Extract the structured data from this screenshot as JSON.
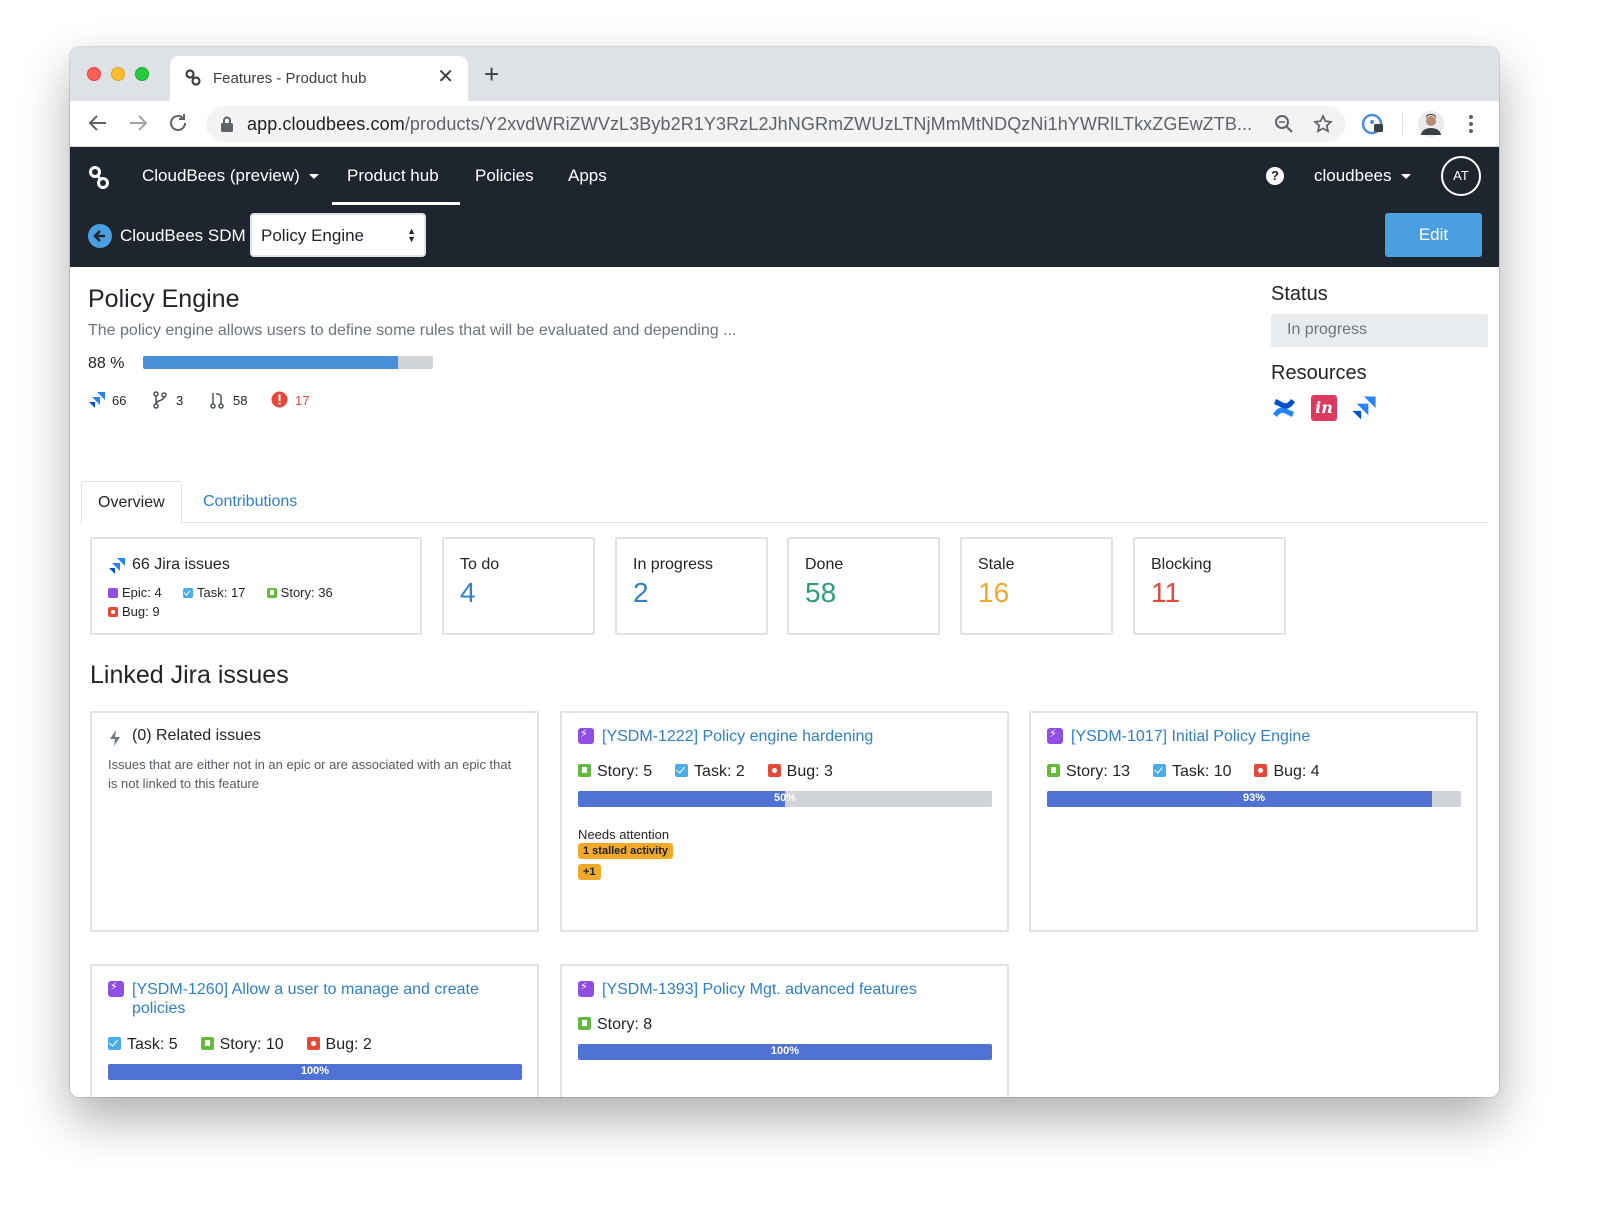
{
  "browser": {
    "tab_title": "Features - Product hub",
    "tab_close": "✕",
    "new_tab": "+",
    "url_host": "app.cloudbees.com",
    "url_path": "/products/Y2xvdWRiZWVzL3Byb2R1Y3RzL2JhNGRmZWUzLTNjMmMtNDQzNi1hYWRlLTkxZGEwZTB..."
  },
  "appnav": {
    "org": "CloudBees (preview)",
    "items": [
      "Product hub",
      "Policies",
      "Apps"
    ],
    "active": "Product hub",
    "help": "?",
    "account": "cloudbees",
    "avatar": "AT"
  },
  "subnav": {
    "title": "CloudBees SDM",
    "selected_feature": "Policy Engine",
    "edit_label": "Edit"
  },
  "feature": {
    "title": "Policy Engine",
    "description": "The policy engine allows users to define some rules that will be evaluated and depending ...",
    "progress_label": "88 %",
    "progress": 0.88,
    "stats": {
      "jira": "66",
      "branches": "3",
      "pulls": "58",
      "alerts": "17"
    }
  },
  "sidebar": {
    "status_heading": "Status",
    "status_value": "In progress",
    "resources_heading": "Resources",
    "resources": [
      "confluence-icon",
      "invision-icon",
      "jira-icon"
    ]
  },
  "tabs": [
    "Overview",
    "Contributions"
  ],
  "summary": {
    "title": "66 Jira issues",
    "epic": "Epic: 4",
    "task": "Task: 17",
    "story": "Story: 36",
    "bug": "Bug: 9"
  },
  "counts": [
    {
      "label": "To do",
      "value": "4",
      "color": "#2f80c6"
    },
    {
      "label": "In progress",
      "value": "2",
      "color": "#2f80c6"
    },
    {
      "label": "Done",
      "value": "58",
      "color": "#2e9d73"
    },
    {
      "label": "Stale",
      "value": "16",
      "color": "#f0a928"
    },
    {
      "label": "Blocking",
      "value": "11",
      "color": "#e5493a"
    }
  ],
  "linked": {
    "heading": "Linked Jira issues",
    "related_title": "(0) Related issues",
    "related_desc": "Issues that are either not in an epic or are associated with an epic that is not linked to this feature",
    "issues": [
      {
        "title": "[YSDM-1222] Policy engine hardening",
        "c1": "Story: 5",
        "c2": "Task: 2",
        "c3": "Bug: 3",
        "pct": "50%",
        "progress": 0.5,
        "attention": "Needs attention",
        "badge1": "1 stalled activity",
        "badge2": "+1"
      },
      {
        "title": "[YSDM-1017] Initial Policy Engine",
        "c1": "Story: 13",
        "c2": "Task: 10",
        "c3": "Bug: 4",
        "pct": "93%",
        "progress": 0.93
      },
      {
        "title": "[YSDM-1260] Allow a user to manage and create policies",
        "c1": "Task: 5",
        "c2": "Story: 10",
        "c3": "Bug: 2",
        "pct": "100%",
        "progress": 1.0
      },
      {
        "title": "[YSDM-1393] Policy Mgt. advanced features",
        "c1": "Story: 8",
        "pct": "100%",
        "progress": 1.0
      }
    ]
  },
  "colors": {
    "nav_bg": "#1f252e",
    "accent": "#4a9fe0",
    "link": "#2f80c6",
    "bar": "#4f72d4"
  }
}
